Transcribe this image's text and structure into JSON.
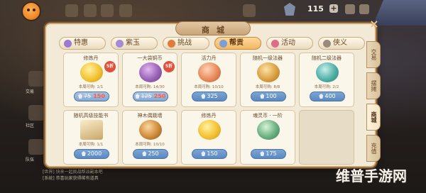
{
  "hud": {
    "gem_count": "115",
    "plus": "+",
    "left_labels": [
      "交易",
      "社区",
      "队伍"
    ]
  },
  "panel": {
    "title": "商城",
    "close": "×",
    "tabs": [
      {
        "label": "特惠",
        "icon": "special-offer-icon",
        "color": "#9c7ad0"
      },
      {
        "label": "紫玉",
        "icon": "jade-icon",
        "color": "#a58ad6"
      },
      {
        "label": "挑战",
        "icon": "challenge-icon",
        "color": "#e07b39"
      },
      {
        "label": "帮贡",
        "icon": "guild-contribution-icon",
        "color": "#7a9fd6"
      },
      {
        "label": "活动",
        "icon": "event-icon",
        "color": "#e06a8a"
      },
      {
        "label": "侠义",
        "icon": "chivalry-icon",
        "color": "#9b8a7a"
      }
    ],
    "active_tab": "帮贡",
    "side_tabs": [
      "交易",
      "摆摊",
      "商城",
      "充值"
    ],
    "active_side_tab": "商城"
  },
  "goods": [
    {
      "name": "修炼丹",
      "limit": "本周可购: 1/1",
      "old_price": "75",
      "new_price": "150",
      "discount": "5折",
      "icon": "pill-icon",
      "color": "#f3c232"
    },
    {
      "name": "一大袋铜币",
      "limit": "本周可购: 14/30",
      "old_price": "125",
      "new_price": "250",
      "discount": "5折",
      "icon": "coin-bag-icon",
      "color": "#9a63b8"
    },
    {
      "name": "活力丹",
      "limit": "本周可购: 10/10",
      "price": "325",
      "icon": "vitality-icon",
      "color": "#e88a5a"
    },
    {
      "name": "随机一级法器",
      "limit": "本周可购: 8/8",
      "price": "100",
      "icon": "artifact-box-icon",
      "color": "#d9a040"
    },
    {
      "name": "随机二级法器",
      "limit": "本周可购: 2/2",
      "price": "400",
      "icon": "artifact-chest-icon",
      "color": "#4fb0a8"
    },
    {
      "name": "随机高级技能书",
      "limit": "本周可购: 1/1",
      "price": "2000",
      "icon": "skill-book-icon",
      "color": "#c9a76a"
    },
    {
      "name": "神木偶跳墙",
      "limit": "本周可购: 10/10",
      "price": "250",
      "icon": "jar-icon",
      "color": "#d08a3a"
    },
    {
      "name": "修炼丹",
      "limit": "",
      "price": "150",
      "icon": "pill-icon",
      "color": "#f3c232"
    },
    {
      "name": "魂灵币 · 一阶",
      "limit": "",
      "price": "175",
      "icon": "spirit-coin-icon",
      "color": "#6ab080"
    }
  ],
  "chat": [
    "[世界] 快来一起挑战帮派副本吧",
    "[系统] 恭喜玩家获得稀有道具"
  ],
  "watermark": "维普手游网"
}
